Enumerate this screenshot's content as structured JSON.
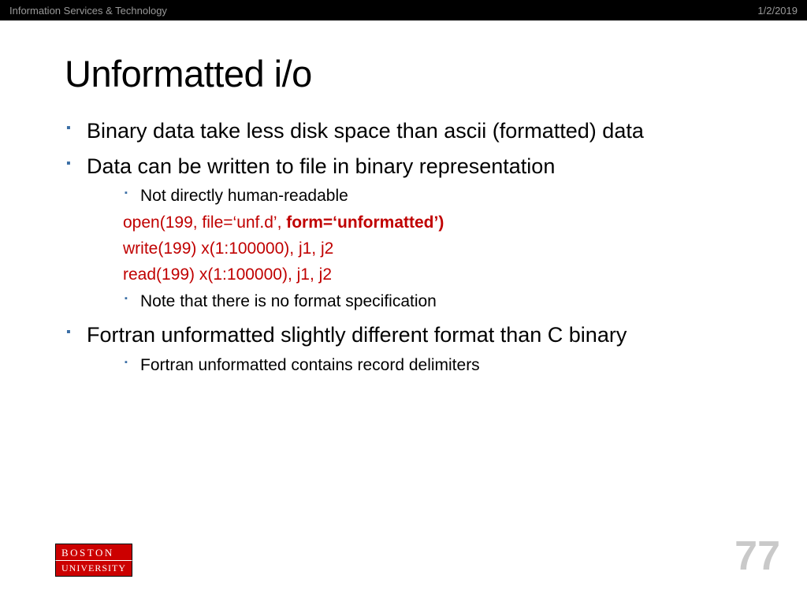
{
  "header": {
    "left": "Information Services & Technology",
    "right": "1/2/2019"
  },
  "title": "Unformatted i/o",
  "bullets": {
    "b1": "Binary data take less disk space than ascii (formatted) data",
    "b2": "Data can be written to file in binary representation",
    "b2_children": {
      "sub1": "Not directly human-readable",
      "code1_pre": "open(199, file=‘unf.d’, ",
      "code1_bold": "form=‘unformatted’)",
      "code2": "write(199)  x(1:100000),  j1, j2",
      "code3": "read(199)   x(1:100000),  j1, j2",
      "sub2": "Note that there is no format specification"
    },
    "b3": "Fortran unformatted slightly different format than C binary",
    "b3_children": {
      "sub1": "Fortran unformatted contains record delimiters"
    }
  },
  "logo": {
    "top": "BOSTON",
    "bottom": "UNIVERSITY"
  },
  "page_number": "77"
}
